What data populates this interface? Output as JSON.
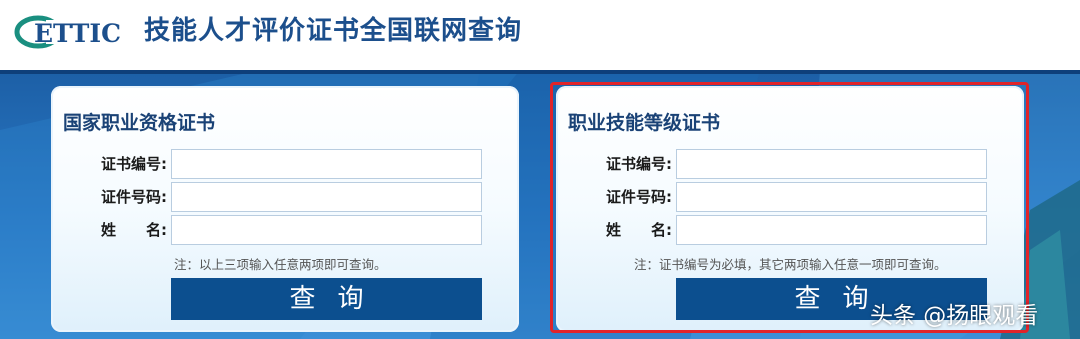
{
  "header": {
    "logo_text": "ETTIC",
    "title": "技能人才评价证书全国联网查询"
  },
  "colors": {
    "brand_blue": "#1c4f8c",
    "button_blue": "#0c4f8f",
    "highlight_red": "#e0242a",
    "logo_green": "#1a8f80"
  },
  "left_card": {
    "title": "国家职业资格证书",
    "fields": [
      {
        "label": "证书编号:",
        "value": ""
      },
      {
        "label": "证件号码:",
        "value": ""
      },
      {
        "label": "姓　　名:",
        "value": ""
      }
    ],
    "note": "注：以上三项输入任意两项即可查询。",
    "button_label": "查询"
  },
  "right_card": {
    "title": "职业技能等级证书",
    "fields": [
      {
        "label": "证书编号:",
        "value": ""
      },
      {
        "label": "证件号码:",
        "value": ""
      },
      {
        "label": "姓　　名:",
        "value": ""
      }
    ],
    "note": "注：证书编号为必填，其它两项输入任意一项即可查询。",
    "button_label": "查询"
  },
  "watermark": "头条 @扬眼观看"
}
